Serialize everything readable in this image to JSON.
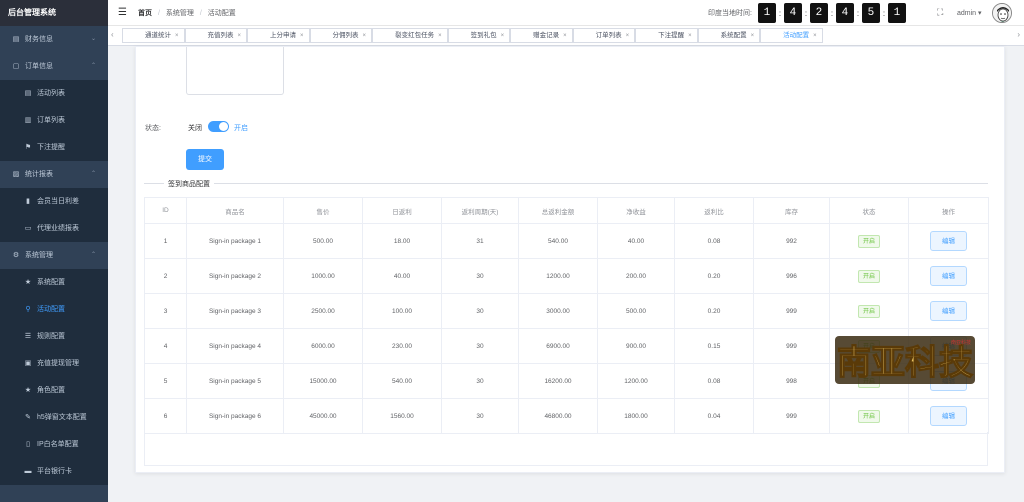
{
  "app": {
    "title": "后台管理系统"
  },
  "sidebar": {
    "items": [
      {
        "label": "财务信息",
        "icon": "wallet-icon",
        "level": "top",
        "arrow": "chevron-down"
      },
      {
        "label": "订单信息",
        "icon": "order-icon",
        "level": "top",
        "arrow": "chevron-up"
      },
      {
        "label": "活动列表",
        "icon": "document-icon",
        "level": "sub"
      },
      {
        "label": "订单列表",
        "icon": "list-icon",
        "level": "sub"
      },
      {
        "label": "下注提醒",
        "icon": "flag-icon",
        "level": "sub"
      },
      {
        "label": "统计报表",
        "icon": "chart-icon",
        "level": "top",
        "arrow": "chevron-up"
      },
      {
        "label": "会员当日利差",
        "icon": "bar-chart-icon",
        "level": "sub"
      },
      {
        "label": "代理业绩报表",
        "icon": "report-icon",
        "level": "sub"
      },
      {
        "label": "系统管理",
        "icon": "gear-icon",
        "level": "top",
        "arrow": "chevron-up"
      },
      {
        "label": "系统配置",
        "icon": "star-icon",
        "level": "sub"
      },
      {
        "label": "活动配置",
        "icon": "key-icon",
        "level": "sub",
        "active": true
      },
      {
        "label": "规则配置",
        "icon": "rules-icon",
        "level": "sub"
      },
      {
        "label": "充值提现管理",
        "icon": "money-icon",
        "level": "sub"
      },
      {
        "label": "角色配置",
        "icon": "star-icon",
        "level": "sub"
      },
      {
        "label": "h5弹窗文本配置",
        "icon": "edit-icon",
        "level": "sub"
      },
      {
        "label": "IP白名单配置",
        "icon": "ip-icon",
        "level": "sub"
      },
      {
        "label": "平台银行卡",
        "icon": "card-icon",
        "level": "sub"
      }
    ]
  },
  "header": {
    "breadcrumb": [
      "首页",
      "系统管理",
      "活动配置"
    ],
    "time_label": "印度当地时间:",
    "time_digits": [
      "1",
      "4",
      "2",
      "4",
      "5",
      "1"
    ],
    "user_name": "admin"
  },
  "tags": [
    {
      "label": "通道统计"
    },
    {
      "label": "充值列表"
    },
    {
      "label": "上分申请"
    },
    {
      "label": "分佣列表"
    },
    {
      "label": "裂变红包任务"
    },
    {
      "label": "签到礼包"
    },
    {
      "label": "赠金记录"
    },
    {
      "label": "订单列表"
    },
    {
      "label": "下注提醒"
    },
    {
      "label": "系统配置"
    },
    {
      "label": "活动配置",
      "active": true
    }
  ],
  "form": {
    "status_label": "状态:",
    "switch_off_text": "关闭",
    "switch_on_text": "开启",
    "switch_on": true,
    "submit_label": "提交"
  },
  "section": {
    "title": "签到商品配置"
  },
  "table": {
    "columns": [
      "ID",
      "商品名",
      "售价",
      "日返利",
      "返利周期(天)",
      "总返利金额",
      "净收益",
      "返利比",
      "库存",
      "状态",
      "操作"
    ],
    "rows": [
      {
        "id": "1",
        "name": "Sign-in package 1",
        "price": "500.00",
        "daily": "18.00",
        "cycle": "31",
        "total": "540.00",
        "net": "40.00",
        "ratio": "0.08",
        "stock": "992",
        "status": "开启",
        "action": "编辑"
      },
      {
        "id": "2",
        "name": "Sign-in package 2",
        "price": "1000.00",
        "daily": "40.00",
        "cycle": "30",
        "total": "1200.00",
        "net": "200.00",
        "ratio": "0.20",
        "stock": "996",
        "status": "开启",
        "action": "编辑"
      },
      {
        "id": "3",
        "name": "Sign-in package 3",
        "price": "2500.00",
        "daily": "100.00",
        "cycle": "30",
        "total": "3000.00",
        "net": "500.00",
        "ratio": "0.20",
        "stock": "999",
        "status": "开启",
        "action": "编辑"
      },
      {
        "id": "4",
        "name": "Sign-in package 4",
        "price": "6000.00",
        "daily": "230.00",
        "cycle": "30",
        "total": "6900.00",
        "net": "900.00",
        "ratio": "0.15",
        "stock": "999",
        "status": "开启",
        "action": "编辑"
      },
      {
        "id": "5",
        "name": "Sign-in package 5",
        "price": "15000.00",
        "daily": "540.00",
        "cycle": "30",
        "total": "16200.00",
        "net": "1200.00",
        "ratio": "0.08",
        "stock": "998",
        "status": "开启",
        "action": "编辑"
      },
      {
        "id": "6",
        "name": "Sign-in package 6",
        "price": "45000.00",
        "daily": "1560.00",
        "cycle": "30",
        "total": "46800.00",
        "net": "1800.00",
        "ratio": "0.04",
        "stock": "999",
        "status": "开启",
        "action": "编辑"
      }
    ]
  },
  "watermark": {
    "text": "南亚科技",
    "small_text": "南亚科技"
  },
  "colors": {
    "sidebar": "#304156",
    "primary": "#409eff",
    "success": "#67c23a"
  }
}
